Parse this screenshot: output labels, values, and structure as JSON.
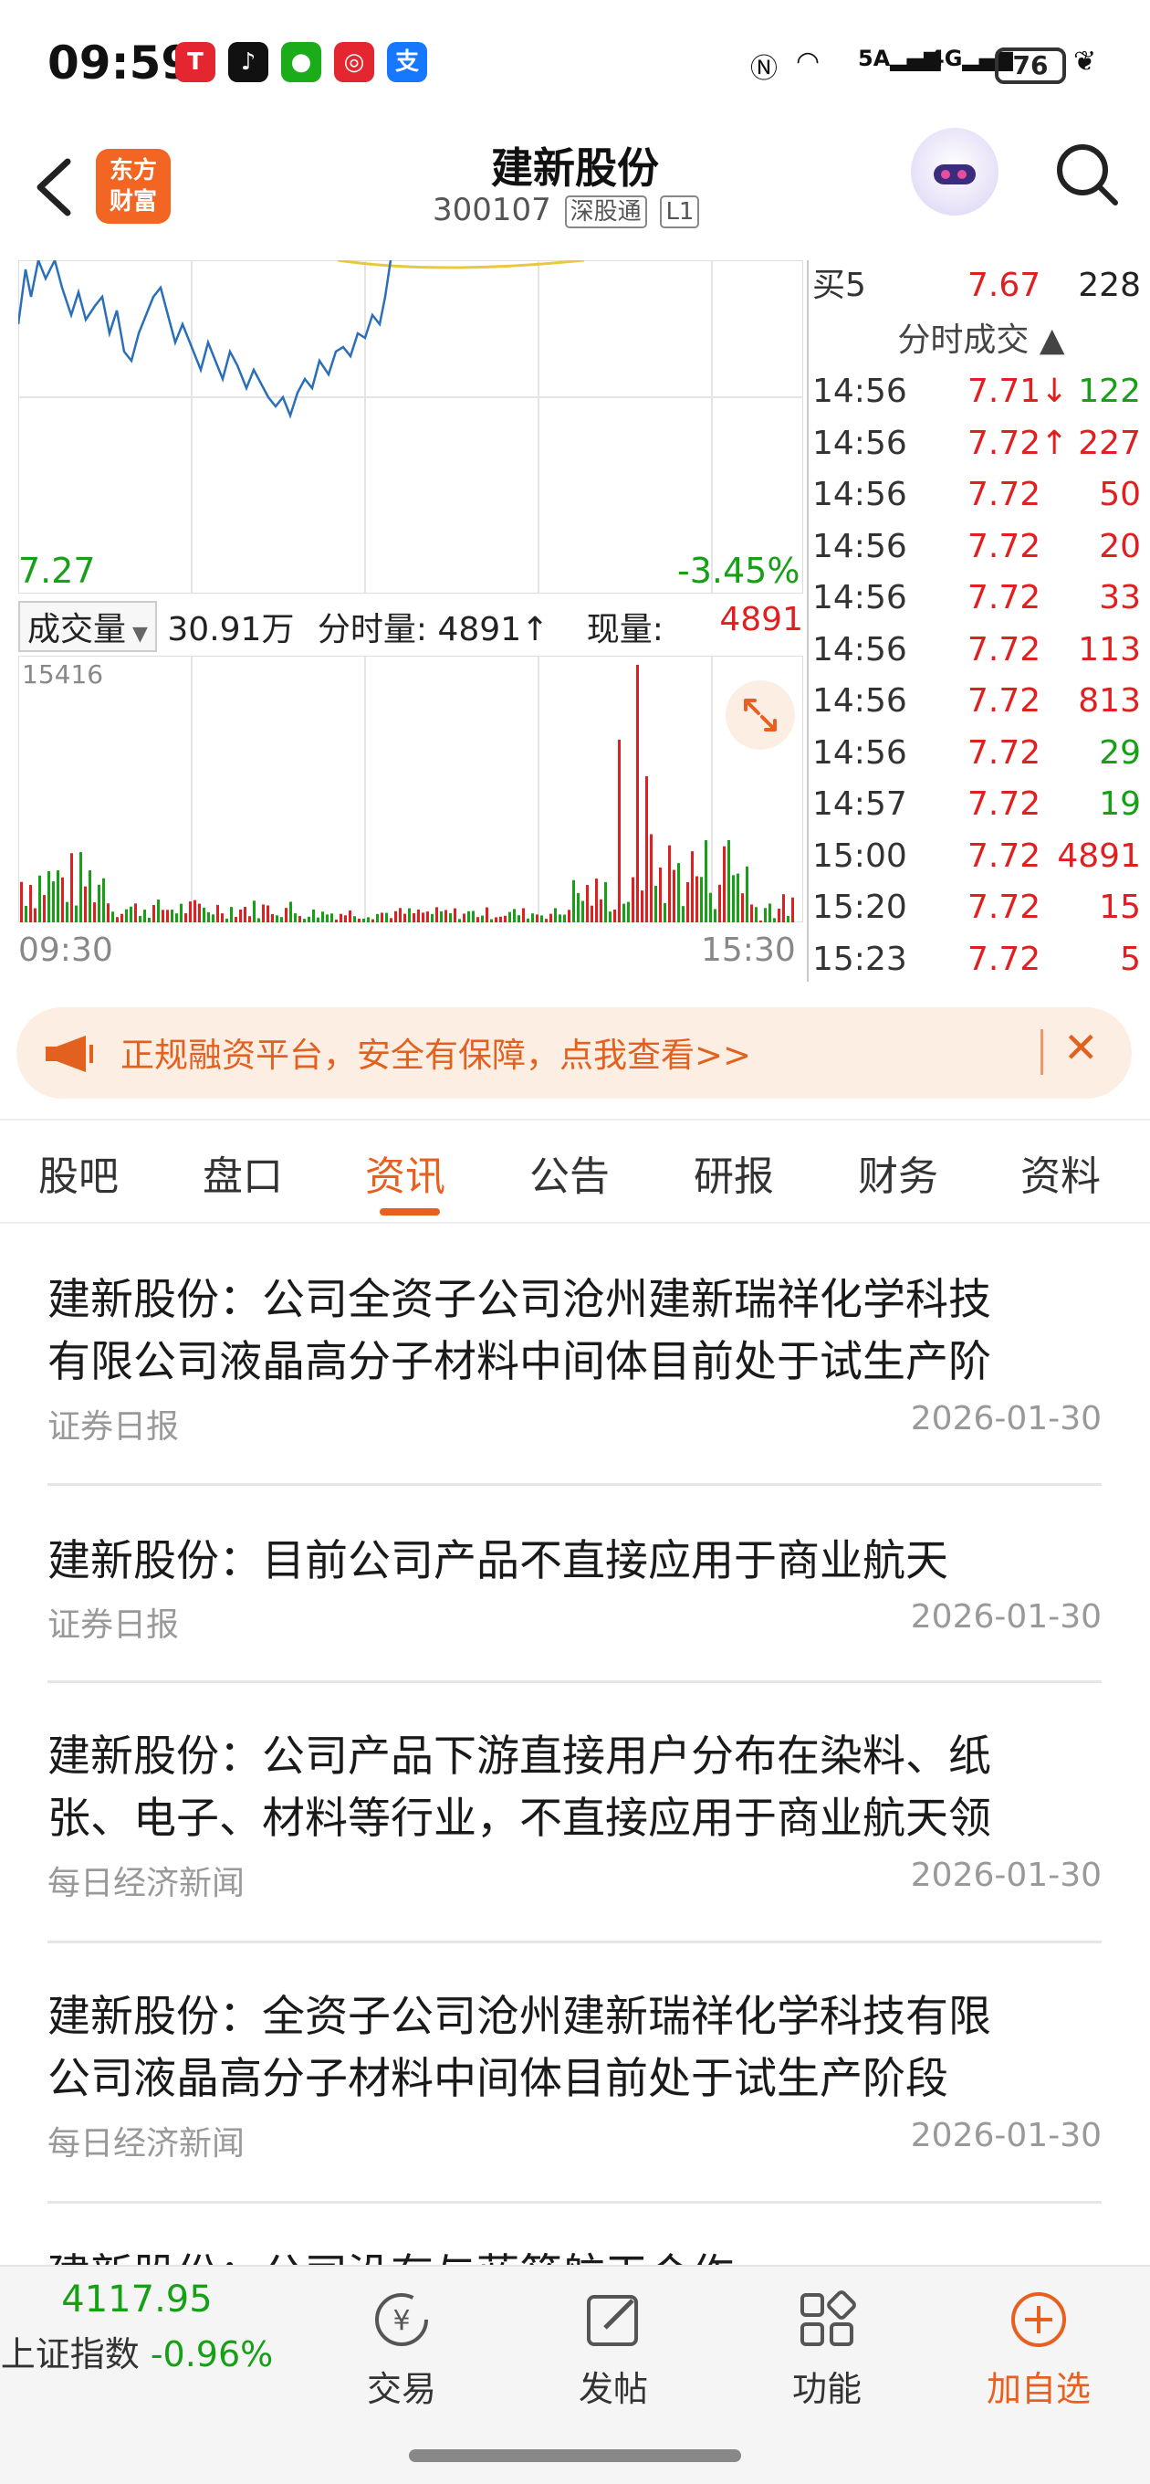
{
  "status": {
    "time": "09:59",
    "battery": "76",
    "signal1": "5A",
    "signal2": "4G"
  },
  "header": {
    "title": "建新股份",
    "code": "300107",
    "tag1": "深股通",
    "tag2": "L1",
    "logo_line1": "东方",
    "logo_line2": "财富"
  },
  "chart": {
    "low_price": "7.27",
    "low_pct": "-3.45%",
    "volume_selector": "成交量",
    "total_volume": "30.91万",
    "tick_volume_label": "分时量:",
    "tick_volume": "4891↑",
    "current_label": "现量:",
    "current_volume": "4891",
    "vol_max": "15416",
    "time_start": "09:30",
    "time_end": "15:30"
  },
  "trades": {
    "buy5": {
      "label": "买5",
      "price": "7.67",
      "qty": "228"
    },
    "header": "分时成交 ▲",
    "rows": [
      {
        "time": "14:56",
        "price": "7.71↓",
        "qty": "122",
        "side": "sell"
      },
      {
        "time": "14:56",
        "price": "7.72↑",
        "qty": "227",
        "side": "buy"
      },
      {
        "time": "14:56",
        "price": "7.72",
        "qty": "50",
        "side": "buy"
      },
      {
        "time": "14:56",
        "price": "7.72",
        "qty": "20",
        "side": "buy"
      },
      {
        "time": "14:56",
        "price": "7.72",
        "qty": "33",
        "side": "buy"
      },
      {
        "time": "14:56",
        "price": "7.72",
        "qty": "113",
        "side": "buy"
      },
      {
        "time": "14:56",
        "price": "7.72",
        "qty": "813",
        "side": "buy"
      },
      {
        "time": "14:56",
        "price": "7.72",
        "qty": "29",
        "side": "sell"
      },
      {
        "time": "14:57",
        "price": "7.72",
        "qty": "19",
        "side": "sell"
      },
      {
        "time": "15:00",
        "price": "7.72",
        "qty": "4891",
        "side": "buy"
      },
      {
        "time": "15:20",
        "price": "7.72",
        "qty": "15",
        "side": "buy"
      },
      {
        "time": "15:23",
        "price": "7.72",
        "qty": "5",
        "side": "buy"
      }
    ]
  },
  "banner": {
    "text": "正规融资平台，安全有保障，点我查看>>"
  },
  "tabs": [
    "股吧",
    "盘口",
    "资讯",
    "公告",
    "研报",
    "财务",
    "资料"
  ],
  "news": [
    {
      "line1": "建新股份：公司全资子公司沧州建新瑞祥化学科技",
      "line2": "有限公司液晶高分子材料中间体目前处于试生产阶",
      "source": "证券日报",
      "date": "2026-01-30"
    },
    {
      "line1": "建新股份：目前公司产品不直接应用于商业航天",
      "line2": "",
      "source": "证券日报",
      "date": "2026-01-30"
    },
    {
      "line1": "建新股份：公司产品下游直接用户分布在染料、纸",
      "line2": "张、电子、材料等行业，不直接应用于商业航天领",
      "source": "每日经济新闻",
      "date": "2026-01-30"
    },
    {
      "line1": "建新股份：全资子公司沧州建新瑞祥化学科技有限",
      "line2": "公司液晶高分子材料中间体目前处于试生产阶段",
      "source": "每日经济新闻",
      "date": "2026-01-30"
    },
    {
      "line1": "建新股份：公司没有与蓝箭航天合作",
      "line2": "",
      "source": "",
      "date": ""
    }
  ],
  "bottom": {
    "index_value": "4117.95",
    "index_name": "上证指数",
    "index_change": "-0.96%",
    "nav": [
      "交易",
      "发帖",
      "功能",
      "加自选"
    ]
  },
  "colors": {
    "accent": "#e8601f",
    "up": "#e02020",
    "down": "#16a016"
  }
}
